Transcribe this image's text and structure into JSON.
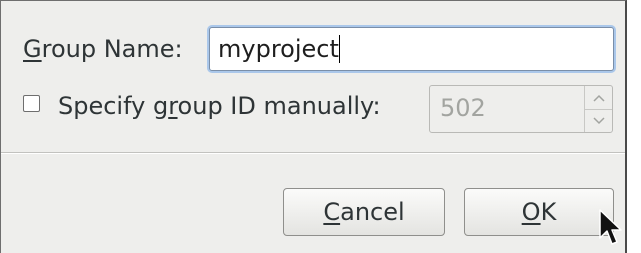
{
  "dialog": {
    "group_name": {
      "label_mnemonic": "G",
      "label_rest": "roup Name:",
      "value": "myproject"
    },
    "manual_gid": {
      "checked": false,
      "label_before": "Specify g",
      "label_mnemonic": "r",
      "label_after": "oup ID manually:",
      "value": "502",
      "enabled": false
    },
    "buttons": {
      "cancel_mnemonic": "C",
      "cancel_rest": "ancel",
      "ok_mnemonic": "O",
      "ok_rest": "K"
    }
  },
  "icons": {
    "spin_up": "chevron-up-icon",
    "spin_down": "chevron-down-icon",
    "cursor": "mouse-pointer-icon"
  }
}
